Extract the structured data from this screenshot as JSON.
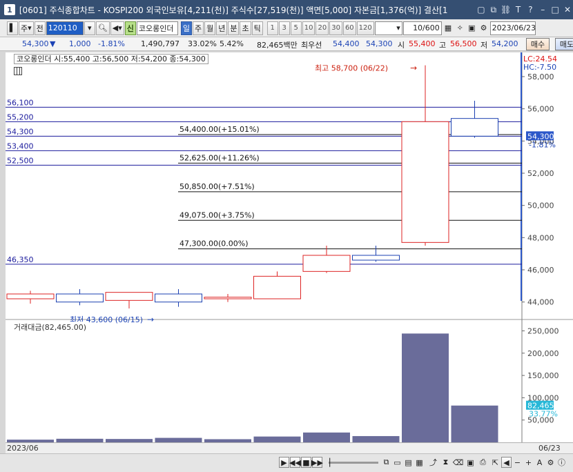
{
  "window": {
    "number": "1",
    "title": "[0601] 주식종합차트 - KOSPI200 외국인보유[4,211(천)] 주식수[27,519(천)] 액면[5,000] 자본금[1,376(억)] 결산[1",
    "icons": [
      "restore-icon",
      "copy-icon",
      "link-icon",
      "font-icon",
      "help-icon",
      "minimize-icon",
      "maximize-icon",
      "close-icon"
    ]
  },
  "toolbar": {
    "type_label": "주",
    "all_label": "전",
    "code_value": "120110",
    "new_badge": "신",
    "stock_name": "코오롱인더",
    "period_tabs": [
      "일",
      "주",
      "월",
      "년",
      "분",
      "초",
      "틱"
    ],
    "active_period": "일",
    "interval_buttons": [
      "1",
      "3",
      "5",
      "10",
      "20",
      "30",
      "60",
      "120"
    ],
    "count_value": "10/600",
    "date_value": "2023/06/23"
  },
  "infobar": {
    "price": "54,300",
    "change_arrow": "▼",
    "change": "1,000",
    "change_pct": "-1.81%",
    "volume": "1,490,797",
    "vol_ratio": "33.02%",
    "turnover": "5.42%",
    "amount": "82,465백만",
    "best_ask_label": "최우선",
    "best_ask": "54,400",
    "best_bid": "54,300",
    "open_label": "시",
    "open": "55,400",
    "high_label": "고",
    "high": "56,500",
    "low_label": "저",
    "low": "54,200",
    "buy_label": "매수",
    "sell_label": "매도"
  },
  "chart": {
    "legend": "코오롱인더 시:55,400 고:56,500 저:54,200 종:54,300",
    "lc_label": "LC:24.54",
    "hc_label": "HC:-7.50",
    "max_label": "최고 58,700 (06/22)",
    "min_label": "최저 43,600 (06/15)",
    "current_price_label": "54,300",
    "current_change_label": "-1.81%",
    "y_ticks": [
      "58,000",
      "56,000",
      "54,000",
      "52,000",
      "50,000",
      "48,000",
      "46,000",
      "44,000"
    ],
    "h_lines": [
      {
        "label": "56,100",
        "value": 56100,
        "color": "#1a1a9c"
      },
      {
        "label": "55,200",
        "value": 55200,
        "color": "#1a1a9c"
      },
      {
        "label": "54,300",
        "value": 54300,
        "color": "#1a1a9c"
      },
      {
        "label": "53,400",
        "value": 53400,
        "color": "#1a1a9c"
      },
      {
        "label": "52,500",
        "value": 52500,
        "color": "#1a1a9c"
      },
      {
        "label": "46,350",
        "value": 46350,
        "color": "#1a1a9c"
      }
    ],
    "fib_lines": [
      {
        "label": "54,400.00(+15.01%)",
        "value": 54400
      },
      {
        "label": "52,625.00(+11.26%)",
        "value": 52625
      },
      {
        "label": "50,850.00(+7.51%)",
        "value": 50850
      },
      {
        "label": "49,075.00(+3.75%)",
        "value": 49075
      },
      {
        "label": "47,300.00(0.00%)",
        "value": 47300
      }
    ]
  },
  "chart_data": {
    "type": "bar",
    "title": "코오롱인더",
    "ylim": [
      43000,
      59500
    ],
    "candles": [
      {
        "open": 44200,
        "high": 44700,
        "low": 43900,
        "close": 44500
      },
      {
        "open": 44500,
        "high": 44800,
        "low": 43800,
        "close": 44000
      },
      {
        "open": 44100,
        "high": 44400,
        "low": 43600,
        "close": 44600
      },
      {
        "open": 44500,
        "high": 44800,
        "low": 43700,
        "close": 44000
      },
      {
        "open": 44200,
        "high": 44500,
        "low": 44000,
        "close": 44300
      },
      {
        "open": 44200,
        "high": 45900,
        "low": 44200,
        "close": 45600
      },
      {
        "open": 45900,
        "high": 47500,
        "low": 45800,
        "close": 46900
      },
      {
        "open": 46900,
        "high": 47500,
        "low": 46500,
        "close": 46600
      },
      {
        "open": 47700,
        "high": 58700,
        "low": 47500,
        "close": 55200
      },
      {
        "open": 55400,
        "high": 56500,
        "low": 54200,
        "close": 54300
      }
    ],
    "volume": {
      "label": "거래대금(82,465.00)",
      "ylim": [
        0,
        260000
      ],
      "y_ticks": [
        "250,000",
        "200,000",
        "150,000",
        "100,000",
        "50,000"
      ],
      "values": [
        6000,
        8000,
        7500,
        10000,
        7000,
        13000,
        22000,
        14000,
        244000,
        82465
      ],
      "current_label": "82,465",
      "current_pct": "33.77%"
    },
    "start_date": "2023/06",
    "end_date": "06/23"
  },
  "colors": {
    "up": "#d22",
    "down": "#1a3fb0",
    "volume_bar": "#6a6c9a",
    "title_bg": "#354f72"
  }
}
